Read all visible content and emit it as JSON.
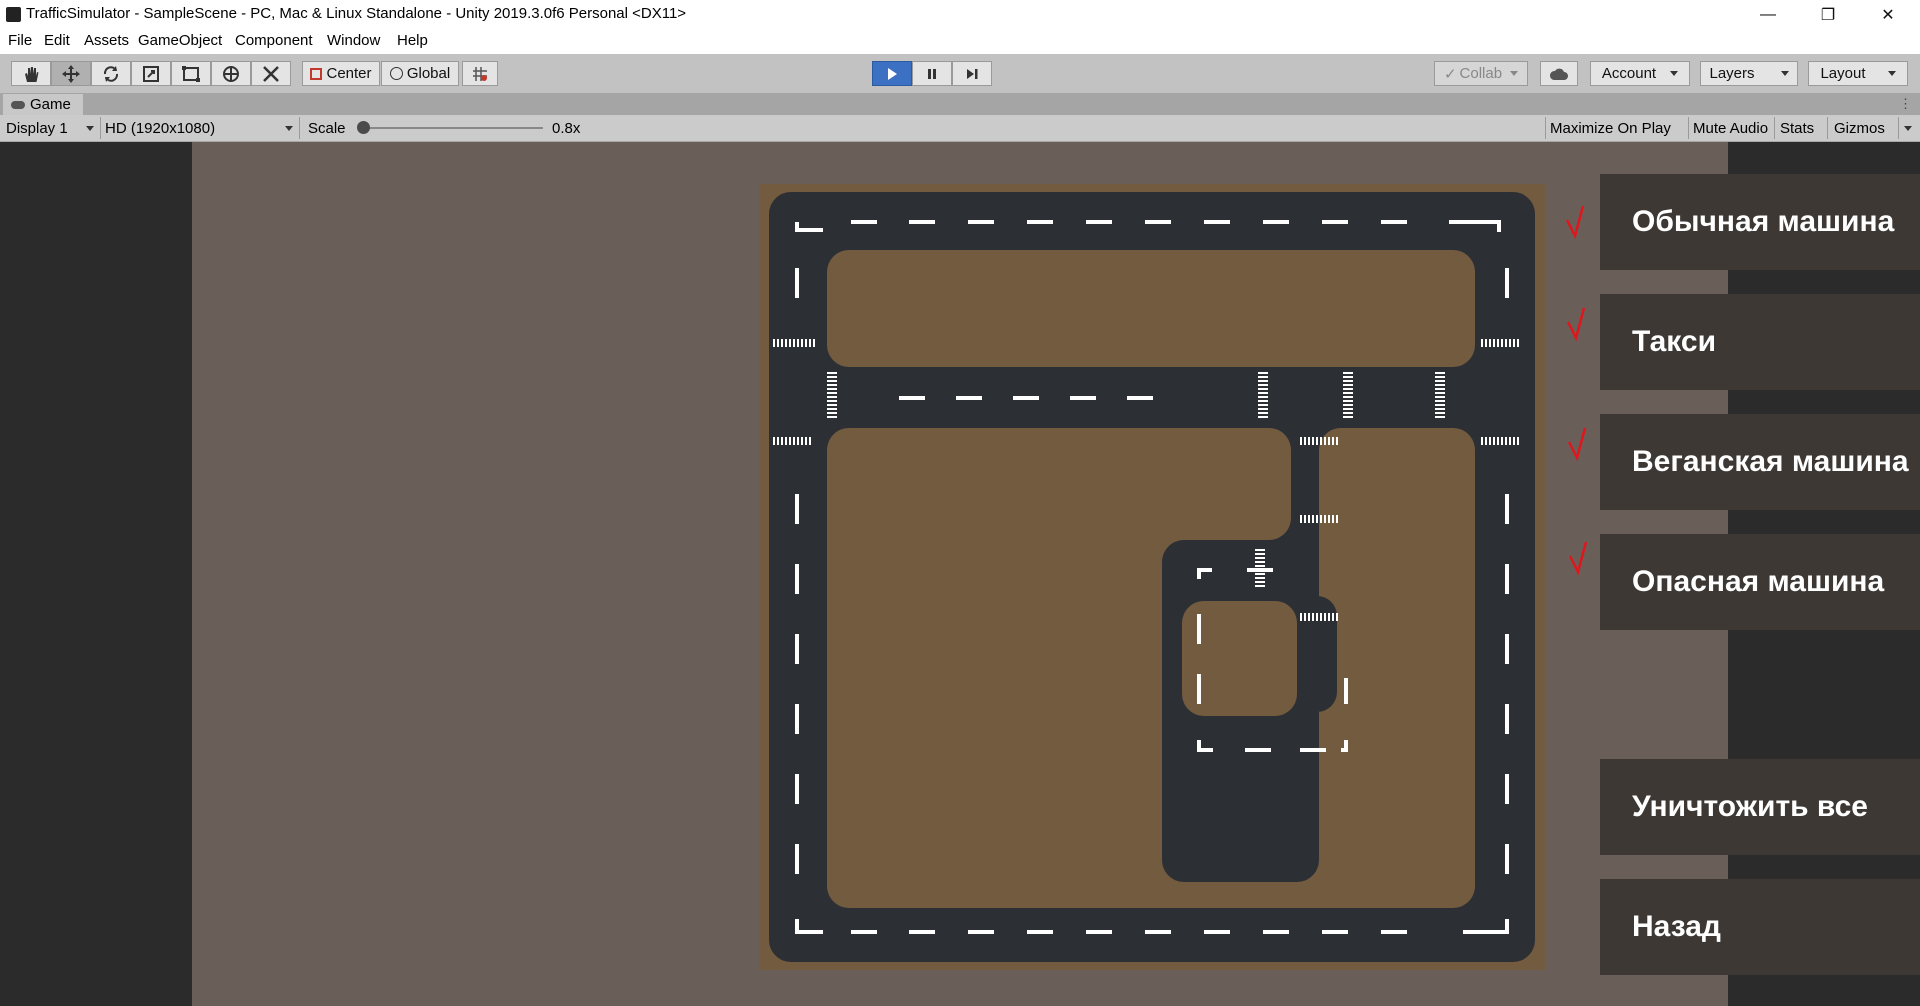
{
  "window": {
    "title": "TrafficSimulator - SampleScene - PC, Mac & Linux Standalone - Unity 2019.3.0f6 Personal <DX11>"
  },
  "menu": [
    "File",
    "Edit",
    "Assets",
    "GameObject",
    "Component",
    "Window",
    "Help"
  ],
  "toolbar": {
    "tools": [
      "hand-tool",
      "move-tool",
      "rotate-tool",
      "scale-tool",
      "rect-tool",
      "transform-tool",
      "custom-tool"
    ],
    "center_label": "Center",
    "global_label": "Global",
    "collab_label": "Collab",
    "account_label": "Account",
    "layers_label": "Layers",
    "layout_label": "Layout"
  },
  "game_tab": {
    "label": "Game"
  },
  "game_toolbar": {
    "display": "Display 1",
    "resolution": "HD (1920x1080)",
    "scale_label": "Scale",
    "scale_value": "0.8x",
    "scale_fraction": 0.0,
    "maximize": "Maximize On Play",
    "mute": "Mute Audio",
    "stats": "Stats",
    "gizmos": "Gizmos"
  },
  "game_ui": {
    "buttons": [
      "Обычная машина",
      "Такси",
      "Веганская машина",
      "Опасная машина"
    ],
    "destroy_all": "Уничтожить все",
    "back": "Назад"
  },
  "colors": {
    "title_bg": "#ffffff",
    "toolbar_bg": "#c2c2c2",
    "play_active": "#3c70c2",
    "viewport_bg": "#6a5f58",
    "road": "#2c2f34",
    "ground": "#735b40",
    "panel_button": "#3d3834",
    "checkmark": "#e0161d"
  }
}
